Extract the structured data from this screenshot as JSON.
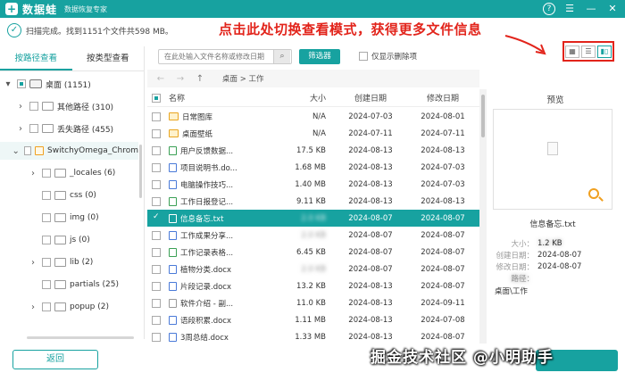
{
  "titlebar": {
    "logo_char": "+",
    "app_name": "数据蛙",
    "app_sub": "数据恢复专家",
    "help": "?",
    "menu": "☰",
    "minimize": "—",
    "close": "✕"
  },
  "status": {
    "text": "扫描完成。找到1151个文件共598 MB。"
  },
  "annotation": {
    "text": "点击此处切换查看模式，获得更多文件信息"
  },
  "left_tabs": [
    "按路径查看",
    "按类型查看"
  ],
  "tree": [
    {
      "label": "桌面 (1151)",
      "level": 0,
      "expander": "▾",
      "check": "partial",
      "icon": "drive"
    },
    {
      "label": "其他路径 (310)",
      "level": 1,
      "expander": "›",
      "check": "none",
      "icon": "folder"
    },
    {
      "label": "丢失路径 (455)",
      "level": 1,
      "expander": "›",
      "check": "none",
      "icon": "folder"
    },
    {
      "label": "SwitchyOmega_Chrom",
      "level": 1,
      "expander": "⌄",
      "check": "none",
      "icon": "folder-orange",
      "selected": true
    },
    {
      "label": "_locales (6)",
      "level": 2,
      "expander": "›",
      "check": "none",
      "icon": "folder"
    },
    {
      "label": "css (0)",
      "level": 2,
      "expander": "",
      "check": "none",
      "icon": "folder"
    },
    {
      "label": "img (0)",
      "level": 2,
      "expander": "",
      "check": "none",
      "icon": "folder"
    },
    {
      "label": "js (0)",
      "level": 2,
      "expander": "",
      "check": "none",
      "icon": "folder"
    },
    {
      "label": "lib (2)",
      "level": 2,
      "expander": "›",
      "check": "none",
      "icon": "folder"
    },
    {
      "label": "partials (25)",
      "level": 2,
      "expander": "",
      "check": "none",
      "icon": "folder"
    },
    {
      "label": "popup (2)",
      "level": 2,
      "expander": "›",
      "check": "none",
      "icon": "folder"
    }
  ],
  "toolbar": {
    "search_placeholder": "在此处输入文件名称或修改日期",
    "search_icon": "⌕",
    "filter_label": "筛选器",
    "deleted_only_label": "仅显示删除项"
  },
  "view_modes": [
    {
      "icon": "▦",
      "name": "thumbnail"
    },
    {
      "icon": "☰",
      "name": "list"
    },
    {
      "icon": "▮▯",
      "name": "preview"
    }
  ],
  "nav": {
    "back": "←",
    "forward": "→",
    "up": "↑",
    "path": "桌面 > 工作"
  },
  "table": {
    "headers": {
      "name": "名称",
      "size": "大小",
      "ctime": "创建日期",
      "mtime": "修改日期"
    },
    "rows": [
      {
        "name": "日常图库",
        "size": "N/A",
        "ctime": "2024-07-03",
        "mtime": "2024-08-01",
        "icon": "folder"
      },
      {
        "name": "桌面壁纸",
        "size": "N/A",
        "ctime": "2024-07-11",
        "mtime": "2024-07-11",
        "icon": "folder"
      },
      {
        "name": "用户反馈数据...",
        "size": "17.5 KB",
        "ctime": "2024-08-13",
        "mtime": "2024-08-13",
        "icon": "xls"
      },
      {
        "name": "项目说明书.do...",
        "size": "1.68 MB",
        "ctime": "2024-08-13",
        "mtime": "2024-07-03",
        "icon": "doc"
      },
      {
        "name": "电脑操作技巧...",
        "size": "1.40 MB",
        "ctime": "2024-08-13",
        "mtime": "2024-07-03",
        "icon": "doc"
      },
      {
        "name": "工作日报登记...",
        "size": "9.11 KB",
        "ctime": "2024-08-13",
        "mtime": "2024-08-13",
        "icon": "xls"
      },
      {
        "name": "信息备忘.txt",
        "size": "",
        "ctime": "2024-08-07",
        "mtime": "2024-08-07",
        "icon": "txt",
        "selected": true
      },
      {
        "name": "工作成果分享...",
        "size": "",
        "ctime": "2024-08-07",
        "mtime": "2024-08-07",
        "icon": "doc"
      },
      {
        "name": "工作记录表格...",
        "size": "6.45 KB",
        "ctime": "2024-08-07",
        "mtime": "2024-08-07",
        "icon": "xls"
      },
      {
        "name": "植物分类.docx",
        "size": "",
        "ctime": "2024-08-07",
        "mtime": "2024-08-07",
        "icon": "doc"
      },
      {
        "name": "片段记录.docx",
        "size": "13.2 KB",
        "ctime": "2024-08-13",
        "mtime": "2024-08-07",
        "icon": "doc"
      },
      {
        "name": "软件介绍 - 副...",
        "size": "11.0 KB",
        "ctime": "2024-08-13",
        "mtime": "2024-09-11",
        "icon": "txt"
      },
      {
        "name": "语段积累.docx",
        "size": "1.11 MB",
        "ctime": "2024-08-13",
        "mtime": "2024-07-08",
        "icon": "doc"
      },
      {
        "name": "3周总结.docx",
        "size": "1.33 MB",
        "ctime": "2024-08-13",
        "mtime": "2024-08-07",
        "icon": "doc"
      }
    ]
  },
  "preview": {
    "title": "预览",
    "file_name": "信息备忘.txt",
    "size_key": "大小：",
    "created_key": "创建日期：",
    "created_val": "2024-08-07",
    "modified_key": "修改日期：",
    "modified_val": "2024-08-07",
    "path": "桌面\\工作"
  },
  "footer": {
    "back_label": "返回"
  },
  "watermark": {
    "text": "掘金技术社区 @小明助手"
  },
  "colors": {
    "accent": "#17a2a0",
    "annotation": "#e2241b",
    "folder": "#e9a520"
  }
}
